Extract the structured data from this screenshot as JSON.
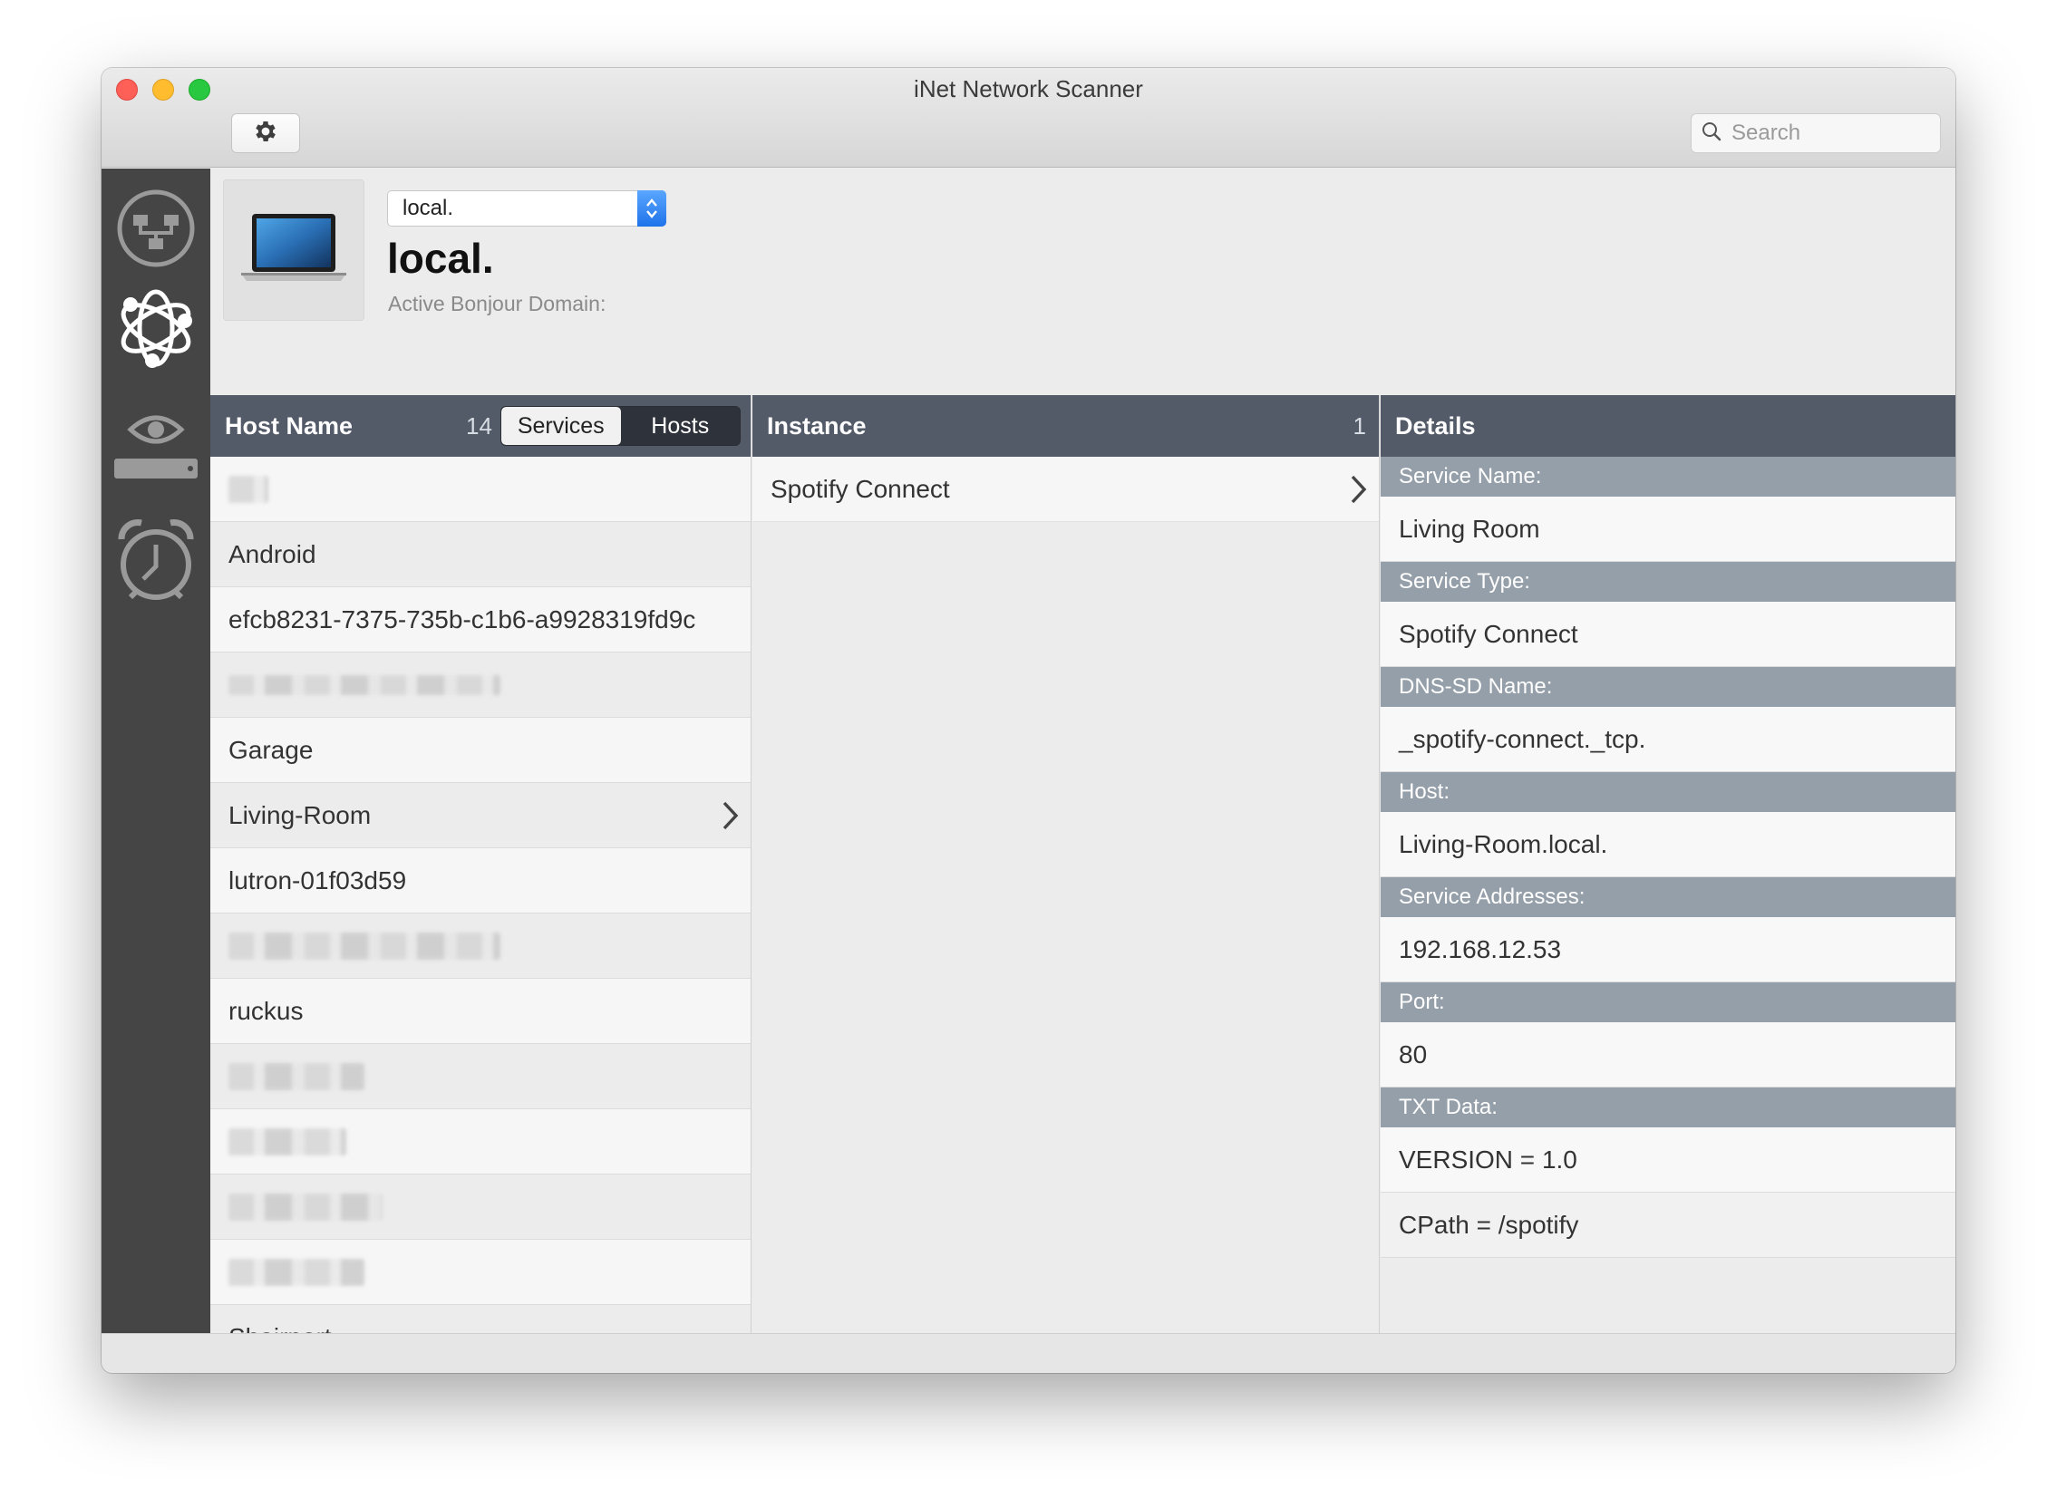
{
  "window": {
    "title": "iNet Network Scanner",
    "search_placeholder": "Search"
  },
  "toolbar": {
    "settings_icon": "gear-icon"
  },
  "sidebar": {
    "items": [
      {
        "icon": "network-icon"
      },
      {
        "icon": "bonjour-icon"
      },
      {
        "icon": "monitor-icon"
      },
      {
        "icon": "alarm-clock-icon"
      }
    ]
  },
  "header": {
    "domain_select_value": "local.",
    "domain_title": "local.",
    "domain_subtitle": "Active Bonjour Domain:"
  },
  "hosts": {
    "column_title": "Host Name",
    "count": "14",
    "segment": {
      "services": "Services",
      "hosts": "Hosts",
      "selected": "Services"
    },
    "rows": [
      {
        "label": "",
        "redacted": true
      },
      {
        "label": "Android"
      },
      {
        "label": "efcb8231-7375-735b-c1b6-a9928319fd9c"
      },
      {
        "label": "",
        "redacted": true
      },
      {
        "label": "Garage"
      },
      {
        "label": "Living-Room",
        "selected": true
      },
      {
        "label": "lutron-01f03d59"
      },
      {
        "label": "",
        "redacted": true
      },
      {
        "label": "ruckus"
      },
      {
        "label": "",
        "redacted": true
      },
      {
        "label": "",
        "redacted": true
      },
      {
        "label": "",
        "redacted": true
      },
      {
        "label": "",
        "redacted": true
      },
      {
        "label": "Shairport"
      }
    ]
  },
  "instance": {
    "column_title": "Instance",
    "count": "1",
    "rows": [
      {
        "label": "Spotify Connect"
      }
    ]
  },
  "details": {
    "column_title": "Details",
    "fields": [
      {
        "label": "Service Name:",
        "values": [
          "Living Room"
        ]
      },
      {
        "label": "Service Type:",
        "values": [
          "Spotify Connect"
        ]
      },
      {
        "label": "DNS-SD Name:",
        "values": [
          "_spotify-connect._tcp."
        ]
      },
      {
        "label": "Host:",
        "values": [
          "Living-Room.local."
        ]
      },
      {
        "label": "Service Addresses:",
        "values": [
          "192.168.12.53"
        ]
      },
      {
        "label": "Port:",
        "values": [
          "80"
        ]
      },
      {
        "label": "TXT Data:",
        "values": [
          "VERSION = 1.0",
          "CPath = /spotify"
        ]
      }
    ]
  },
  "colors": {
    "column_header": "#535a68",
    "detail_label": "#959fa9",
    "sidebar": "#454545",
    "accent_blue": "#1f73ea"
  }
}
